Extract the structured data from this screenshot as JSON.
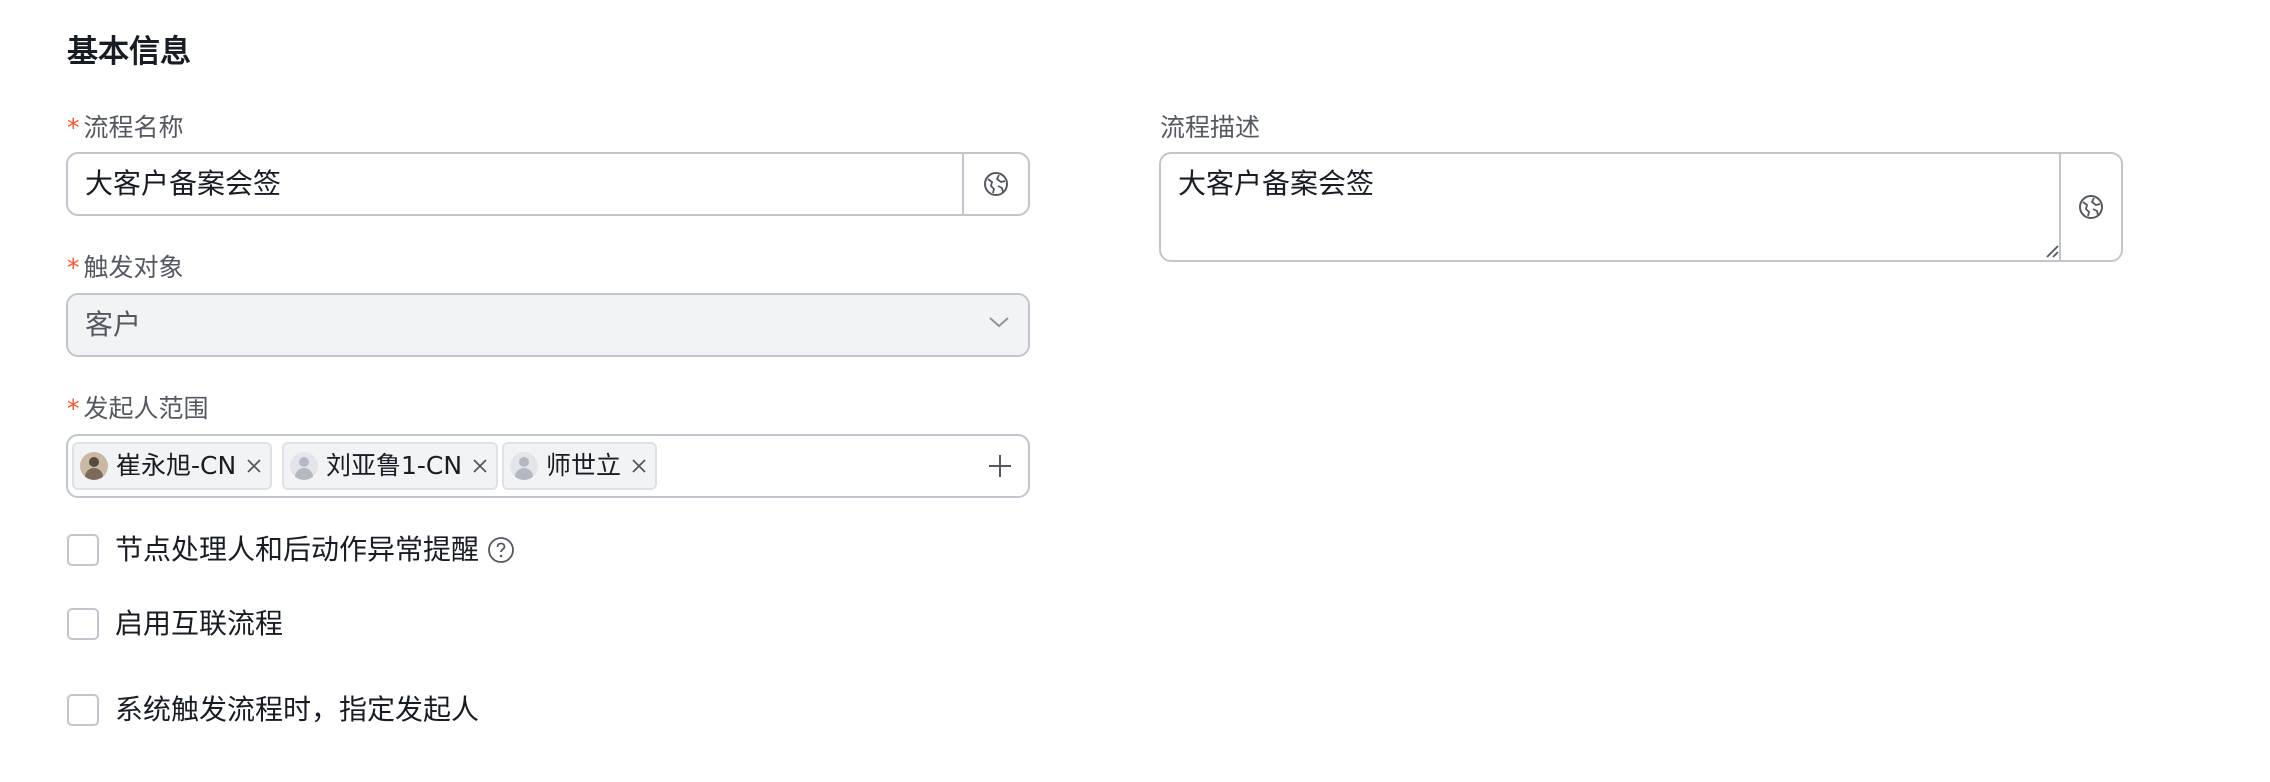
{
  "section": {
    "title": "基本信息"
  },
  "fields": {
    "process_name": {
      "required_mark": "*",
      "label": "流程名称",
      "value": "大客户备案会签"
    },
    "process_description": {
      "label": "流程描述",
      "value": "大客户备案会签"
    },
    "trigger_object": {
      "required_mark": "*",
      "label": "触发对象",
      "value": "客户"
    },
    "initiator_scope": {
      "required_mark": "*",
      "label": "发起人范围",
      "tags": [
        {
          "label": "崔永旭-CN"
        },
        {
          "label": "刘亚鲁1-CN"
        },
        {
          "label": "师世立"
        }
      ]
    }
  },
  "options": [
    {
      "label": "节点处理人和后动作异常提醒",
      "checked": false
    },
    {
      "label": "启用互联流程",
      "checked": false
    },
    {
      "label": "系统触发流程时，指定发起人",
      "checked": false
    }
  ],
  "icons": {
    "translate": "globe-icon",
    "dropdown": "chevron-down-icon",
    "remove": "close-icon",
    "add": "plus-icon",
    "help": "help-circle-icon"
  },
  "colors": {
    "required": "#ff522a",
    "border": "#c1c5ce",
    "disabled_bg": "#f2f3f5",
    "text": "#181c25",
    "label": "#545861"
  }
}
